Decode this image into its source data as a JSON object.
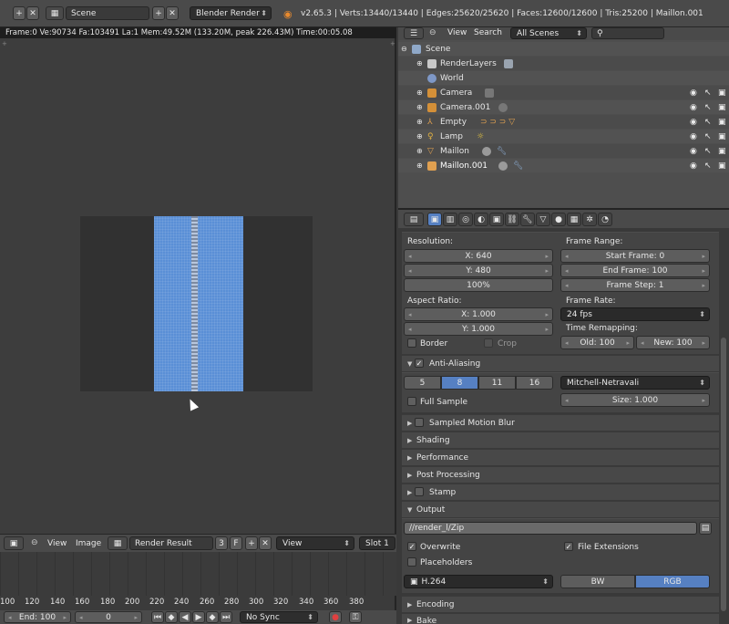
{
  "header": {
    "scene_name": "Scene",
    "engine": "Blender Render",
    "stats": "v2.65.3 | Verts:13440/13440 | Edges:25620/25620 | Faces:12600/12600 | Tris:25200 | Maillon.001"
  },
  "image_editor": {
    "render_info": "Frame:0 Ve:90734 Fa:103491 La:1 Mem:49.52M (133.20M, peak 226.43M) Time:00:05.08",
    "menu_view": "View",
    "menu_image": "Image",
    "image_name": "Render Result",
    "users": "3",
    "fake": "F",
    "view_mode": "View",
    "slot": "Slot 1"
  },
  "timeline": {
    "ticks": [
      "100",
      "120",
      "140",
      "160",
      "180",
      "200",
      "220",
      "240",
      "260",
      "280",
      "300",
      "320",
      "340",
      "360",
      "380"
    ],
    "end": "End: 100",
    "current": "0",
    "sync": "No Sync"
  },
  "outliner": {
    "menu_view": "View",
    "menu_search": "Search",
    "scenes_dropdown": "All Scenes",
    "items": [
      {
        "label": "Scene"
      },
      {
        "label": "RenderLayers"
      },
      {
        "label": "World"
      },
      {
        "label": "Camera"
      },
      {
        "label": "Camera.001"
      },
      {
        "label": "Empty"
      },
      {
        "label": "Lamp"
      },
      {
        "label": "Maillon"
      },
      {
        "label": "Maillon.001"
      }
    ]
  },
  "properties": {
    "resolution_label": "Resolution:",
    "res_x": "X: 640",
    "res_y": "Y: 480",
    "res_pct": "100%",
    "frame_range_label": "Frame Range:",
    "start_frame": "Start Frame: 0",
    "end_frame": "End Frame: 100",
    "frame_step": "Frame Step: 1",
    "aspect_label": "Aspect Ratio:",
    "aspect_x": "X: 1.000",
    "aspect_y": "Y: 1.000",
    "frame_rate_label": "Frame Rate:",
    "frame_rate": "24 fps",
    "time_remap_label": "Time Remapping:",
    "old": "Old: 100",
    "new": "New: 100",
    "border": "Border",
    "crop": "Crop",
    "anti_aliasing": "Anti-Aliasing",
    "aa_samples": [
      "5",
      "8",
      "11",
      "16"
    ],
    "aa_selected": "8",
    "filter": "Mitchell-Netravali",
    "full_sample": "Full Sample",
    "filter_size": "Size: 1.000",
    "sections": [
      "Sampled Motion Blur",
      "Shading",
      "Performance",
      "Post Processing",
      "Stamp",
      "Output"
    ],
    "output_path": "//render_l/Zip",
    "overwrite": "Overwrite",
    "file_extensions": "File Extensions",
    "placeholders": "Placeholders",
    "format": "H.264",
    "bw": "BW",
    "rgb": "RGB",
    "encoding": "Encoding",
    "bake": "Bake"
  },
  "colors": {
    "selected_blue": "#5680c2",
    "render_blue": "#5a8fd6"
  }
}
